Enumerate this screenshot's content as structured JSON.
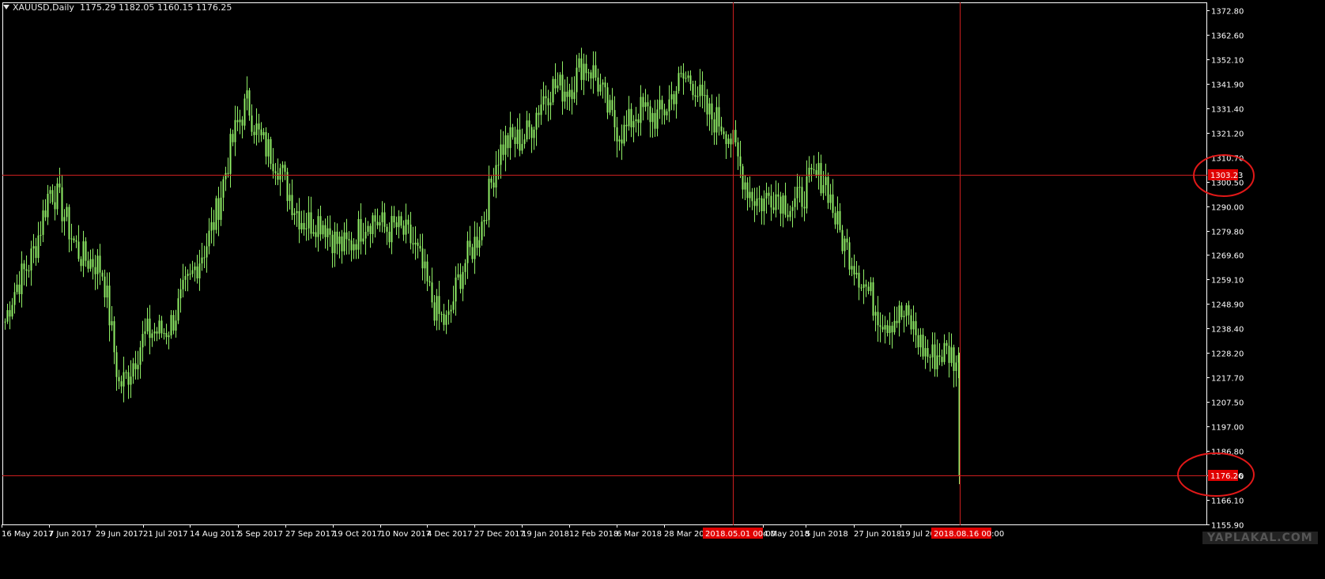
{
  "header": {
    "symbol": "XAUUSD,Daily",
    "ohlc": "1175.29 1182.05 1160.15 1176.25"
  },
  "watermark": "YAPLAKAL.COM",
  "colors": {
    "background": "#000000",
    "candle": "#90ee66",
    "axis": "#ffffff",
    "crosshair": "#cc1f1f",
    "badge": "#e00000"
  },
  "chart_data": {
    "type": "line",
    "title": "",
    "xlabel": "",
    "ylabel": "",
    "ylim": [
      1155.9,
      1377.0
    ],
    "y_ticks": [
      "1372.80",
      "1362.60",
      "1352.10",
      "1341.90",
      "1331.40",
      "1321.20",
      "1310.70",
      "1300.50",
      "1290.00",
      "1279.80",
      "1269.60",
      "1259.10",
      "1248.90",
      "1238.40",
      "1228.20",
      "1217.70",
      "1207.50",
      "1197.00",
      "1186.80",
      "1176.30",
      "1166.10",
      "1155.90"
    ],
    "x_ticks": [
      "16 May 2017",
      "7 Jun 2017",
      "29 Jun 2017",
      "21 Jul 2017",
      "14 Aug 2017",
      "5 Sep 2017",
      "27 Sep 2017",
      "19 Oct 2017",
      "10 Nov 2017",
      "4 Dec 2017",
      "27 Dec 2017",
      "19 Jan 2018",
      "12 Feb 2018",
      "6 Mar 2018",
      "28 Mar 2018",
      "2018.05.01 00:00",
      "4 May 2018",
      "5 Jun 2018",
      "27 Jun 2018",
      "19 Jul 201",
      "2018.08.16 00:00"
    ],
    "series": [
      {
        "x": [
          "16 May 2017",
          "7 Jun 2017",
          "29 Jun 2017",
          "21 Jul 2017",
          "14 Aug 2017",
          "5 Sep 2017",
          "27 Sep 2017",
          "19 Oct 2017",
          "10 Nov 2017",
          "4 Dec 2017",
          "27 Dec 2017",
          "19 Jan 2018",
          "12 Feb 2018",
          "6 Mar 2018",
          "28 Mar 2018",
          "4 May 2018",
          "5 Jun 2018",
          "27 Jun 2018",
          "19 Jul 201"
        ],
        "values": [
          1235,
          1295,
          1258,
          1218,
          1254,
          1335,
          1296,
          1275,
          1285,
          1240,
          1308,
          1330,
          1350,
          1322,
          1343,
          1290,
          1300,
          1254,
          1222
        ]
      }
    ],
    "crosshair_levels": [
      "1303.23",
      "1176.26"
    ]
  }
}
